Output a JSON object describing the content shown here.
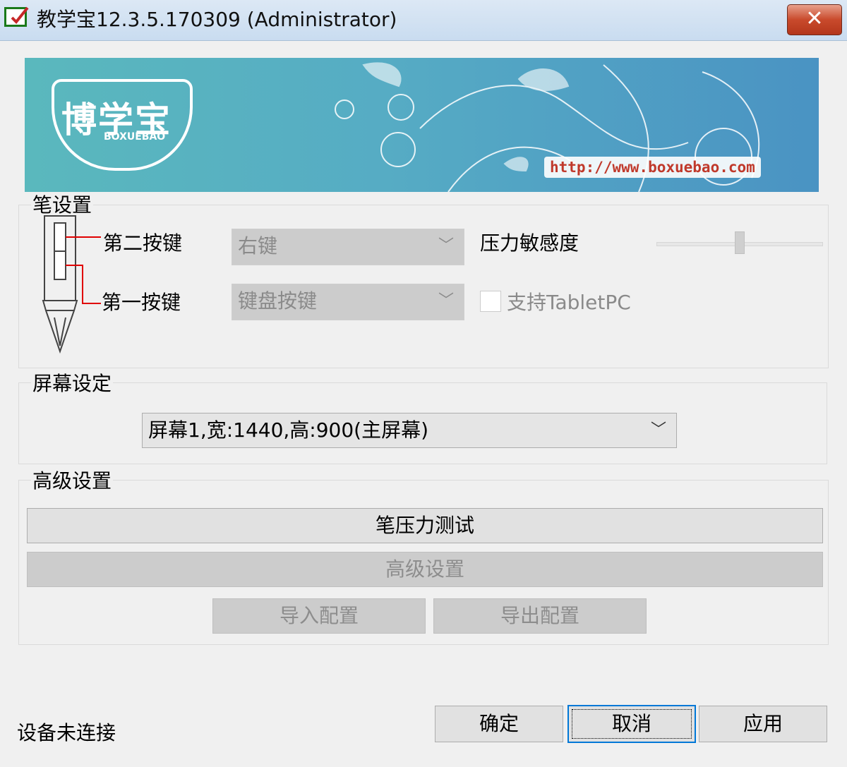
{
  "window": {
    "title": "教学宝12.3.5.170309 (Administrator)",
    "close_label": "✕",
    "app_icon": "checkbox-pen-icon"
  },
  "banner": {
    "logo_cn": "博学宝",
    "logo_en": "BOXUEBAO",
    "url": "http://www.boxuebao.com"
  },
  "pen_settings": {
    "legend": "笔设置",
    "second_button_label": "第二按键",
    "second_button_value": "右键",
    "first_button_label": "第一按键",
    "first_button_value": "键盘按键",
    "pressure_label": "压力敏感度",
    "pressure_level": 0.5,
    "tabletpc_label": "支持TabletPC",
    "tabletpc_checked": false
  },
  "screen_settings": {
    "legend": "屏幕设定",
    "screen_value": "屏幕1,宽:1440,高:900(主屏幕)"
  },
  "advanced": {
    "legend": "高级设置",
    "pressure_test_label": "笔压力测试",
    "advanced_label": "高级设置",
    "import_label": "导入配置",
    "export_label": "导出配置"
  },
  "footer": {
    "status": "设备未连接",
    "ok_label": "确定",
    "cancel_label": "取消",
    "apply_label": "应用"
  },
  "colors": {
    "accent": "#0078d7",
    "pen_line": "#e00000",
    "close": "#c94a2c",
    "url_text": "#c0392b"
  }
}
